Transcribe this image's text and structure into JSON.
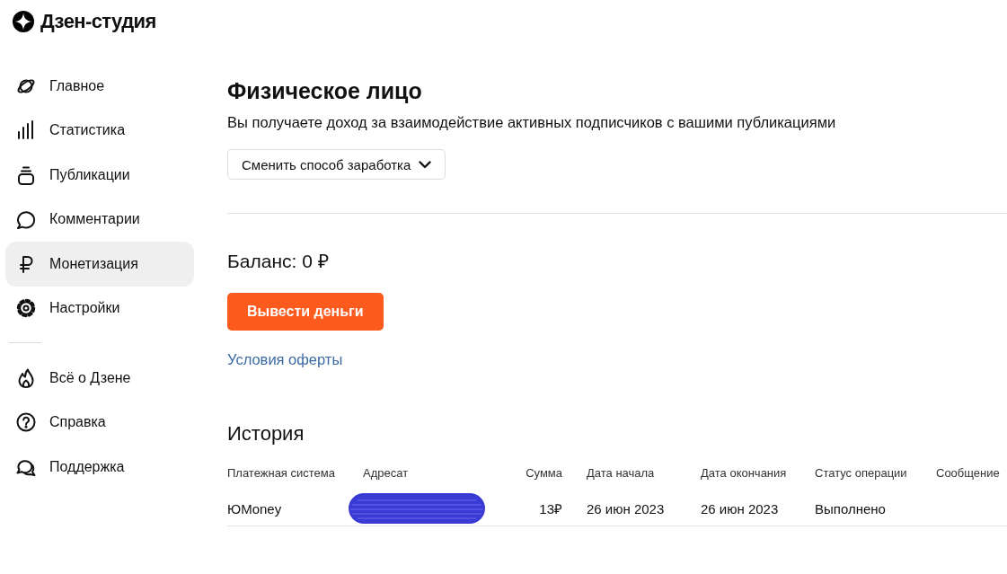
{
  "brand": {
    "name": "Дзен-студия"
  },
  "sidebar": {
    "main_items": [
      {
        "label": "Главное",
        "selected": false
      },
      {
        "label": "Статистика",
        "selected": false
      },
      {
        "label": "Публикации",
        "selected": false
      },
      {
        "label": "Комментарии",
        "selected": false
      },
      {
        "label": "Монетизация",
        "selected": true
      },
      {
        "label": "Настройки",
        "selected": false
      }
    ],
    "secondary_items": [
      {
        "label": "Всё о Дзене",
        "selected": false
      },
      {
        "label": "Справка",
        "selected": false
      },
      {
        "label": "Поддержка",
        "selected": false
      }
    ]
  },
  "monetization": {
    "title": "Физическое лицо",
    "description": "Вы получаете доход за взаимодействие активных подписчиков с вашими публикациями",
    "change_method_button": "Сменить способ заработка",
    "balance": "Баланс: 0 ₽",
    "withdraw_button": "Вывести деньги",
    "offer_link": "Условия оферты"
  },
  "history": {
    "title": "История",
    "columns": [
      "Платежная система",
      "Адресат",
      "Сумма",
      "Дата начала",
      "Дата окончания",
      "Статус операции",
      "Сообщение"
    ],
    "rows": [
      {
        "cells": [
          {
            "kind": "text",
            "text": "ЮMoney"
          },
          {
            "kind": "redacted"
          },
          {
            "kind": "text",
            "text": "13₽"
          },
          {
            "kind": "text",
            "text": "26 июн 2023"
          },
          {
            "kind": "text",
            "text": "26 июн 2023"
          },
          {
            "kind": "text",
            "text": "Выполнено"
          }
        ]
      }
    ]
  }
}
